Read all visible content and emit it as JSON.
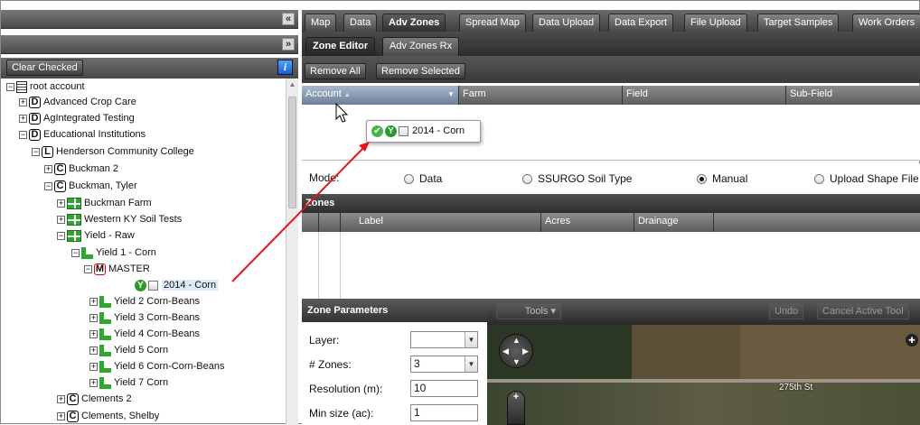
{
  "left_panel": {
    "collapse_icon": "double-chevron-left-icon",
    "expand_icon": "double-chevron-down-icon",
    "clear_checked_label": "Clear Checked",
    "info_label": "i"
  },
  "tree": {
    "items": [
      {
        "label": "root account",
        "icon": "account-book-icon",
        "toggle": "⊟"
      },
      {
        "label": "Advanced Crop Care",
        "badge": "D",
        "toggle": "⊞"
      },
      {
        "label": "AgIntegrated Testing",
        "badge": "D",
        "toggle": "⊞"
      },
      {
        "label": "Educational Institutions",
        "badge": "D",
        "toggle": "⊟"
      },
      {
        "label": "Henderson Community College",
        "badge": "L",
        "toggle": "⊟"
      },
      {
        "label": "Buckman 2",
        "badge": "C",
        "toggle": "⊞"
      },
      {
        "label": "Buckman, Tyler",
        "badge": "C",
        "toggle": "⊟"
      },
      {
        "label": "Buckman Farm",
        "icon": "farm-grid-icon",
        "toggle": "⊞"
      },
      {
        "label": "Western KY Soil Tests",
        "icon": "farm-grid-icon",
        "toggle": "⊞"
      },
      {
        "label": "Yield - Raw",
        "icon": "farm-grid-icon",
        "toggle": "⊟"
      },
      {
        "label": "Yield 1 - Corn",
        "icon": "field-l-icon",
        "toggle": "⊟"
      },
      {
        "label": "MASTER",
        "badge": "M",
        "toggle": "⊟"
      },
      {
        "label": "2014 - Corn",
        "badge": "Y"
      },
      {
        "label": "Yield 2 Corn-Beans",
        "icon": "field-l-icon",
        "toggle": "⊞"
      },
      {
        "label": "Yield 3 Corn-Beans",
        "icon": "field-l-icon",
        "toggle": "⊞"
      },
      {
        "label": "Yield 4 Corn-Beans",
        "icon": "field-l-icon",
        "toggle": "⊞"
      },
      {
        "label": "Yield 5 Corn",
        "icon": "field-l-icon",
        "toggle": "⊞"
      },
      {
        "label": "Yield 6 Corn-Corn-Beans",
        "icon": "field-l-icon",
        "toggle": "⊞"
      },
      {
        "label": "Yield 7 Corn",
        "icon": "field-l-icon",
        "toggle": "⊞"
      },
      {
        "label": "Clements 2",
        "badge": "C",
        "toggle": "⊞"
      },
      {
        "label": "Clements, Shelby",
        "badge": "C",
        "toggle": "⊞"
      }
    ]
  },
  "top_tabs": [
    "Map",
    "Data",
    "Adv Zones",
    "Spread Map",
    "Data Upload",
    "Data Export",
    "File Upload",
    "Target Samples",
    "Work Orders"
  ],
  "active_top_tab": "Adv Zones",
  "sub_tabs": [
    "Zone Editor",
    "Adv Zones Rx"
  ],
  "active_sub_tab": "Zone Editor",
  "editor": {
    "remove_all_label": "Remove All",
    "remove_selected_label": "Remove Selected",
    "columns": [
      "Account",
      "Farm",
      "Field",
      "Sub-Field"
    ],
    "sort_arrow": "▲",
    "dropdown_arrow": "▼",
    "drag_item": {
      "label": "2014 - Corn",
      "badge": "Y",
      "check": "✔"
    }
  },
  "mode": {
    "label": "Mode:",
    "options": [
      "Data",
      "SSURGO Soil Type",
      "Manual",
      "Upload Shape File"
    ],
    "selected": "Manual"
  },
  "zones": {
    "title": "Zones",
    "columns": [
      "Label",
      "Acres",
      "Drainage"
    ]
  },
  "zone_params": {
    "title": "Zone Parameters",
    "fields": [
      {
        "label": "Layer:",
        "value": "",
        "type": "select"
      },
      {
        "label": "# Zones:",
        "value": "3",
        "type": "select"
      },
      {
        "label": "Resolution (m):",
        "value": "10",
        "type": "text"
      },
      {
        "label": "Min size (ac):",
        "value": "1",
        "type": "text"
      }
    ]
  },
  "map": {
    "tools_label": "Tools",
    "undo_label": "Undo",
    "cancel_tool_label": "Cancel Active Tool",
    "road_label": "275th St"
  },
  "colors": {
    "arrow": "#e8141c",
    "active_tab": "#303030",
    "green_icon": "#2fa82f"
  }
}
